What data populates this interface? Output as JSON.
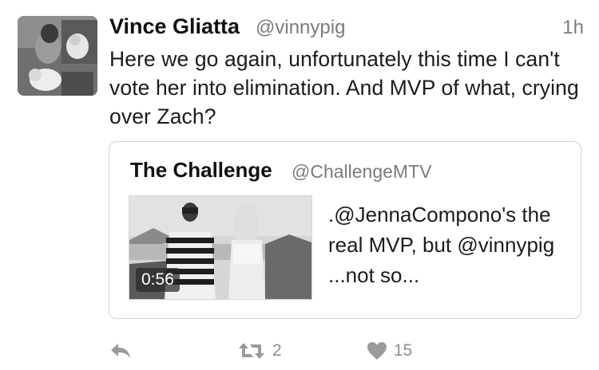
{
  "tweet": {
    "author_name": "Vince Gliatta",
    "author_handle": "@vinnypig",
    "time": "1h",
    "text": "Here we go again, unfortunately this time I can't vote her into elimination. And MVP of what, crying over Zach?"
  },
  "quoted": {
    "author_name": "The Challenge",
    "author_handle": "@ChallengeMTV",
    "video_duration": "0:56",
    "text": ".@JennaCompono's the real MVP, but @vinnypig ...not so..."
  },
  "actions": {
    "reply_icon": "reply-icon",
    "retweet_icon": "retweet-icon",
    "retweet_count": "2",
    "like_icon": "heart-icon",
    "like_count": "15"
  },
  "colors": {
    "text": "#1c1c1c",
    "secondary": "#7b7b7b",
    "border": "#d2d2d2",
    "icon": "#9a9a9a"
  }
}
